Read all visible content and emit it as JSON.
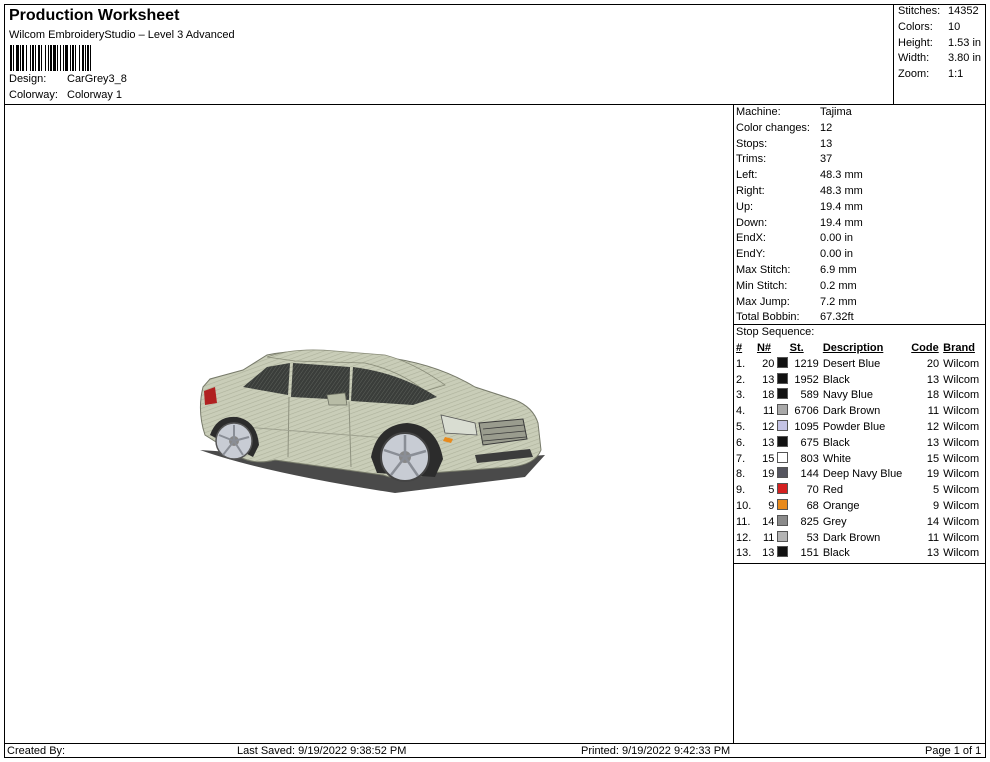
{
  "header": {
    "title": "Production Worksheet",
    "subtitle": "Wilcom EmbroideryStudio – Level 3 Advanced",
    "design_label": "Design:",
    "design_value": "CarGrey3_8",
    "colorway_label": "Colorway:",
    "colorway_value": "Colorway 1"
  },
  "summary": [
    {
      "label": "Stitches:",
      "value": "14352"
    },
    {
      "label": "Colors:",
      "value": "10"
    },
    {
      "label": "Height:",
      "value": "1.53 in"
    },
    {
      "label": "Width:",
      "value": "3.80 in"
    },
    {
      "label": "Zoom:",
      "value": "1:1"
    }
  ],
  "properties": [
    {
      "label": "Machine:",
      "value": "Tajima"
    },
    {
      "label": "Color changes:",
      "value": "12"
    },
    {
      "label": "Stops:",
      "value": "13"
    },
    {
      "label": "Trims:",
      "value": "37"
    },
    {
      "label": "Left:",
      "value": "48.3 mm"
    },
    {
      "label": "Right:",
      "value": "48.3 mm"
    },
    {
      "label": "Up:",
      "value": "19.4 mm"
    },
    {
      "label": "Down:",
      "value": "19.4 mm"
    },
    {
      "label": "EndX:",
      "value": "0.00 in"
    },
    {
      "label": "EndY:",
      "value": "0.00 in"
    },
    {
      "label": "Max Stitch:",
      "value": "6.9 mm"
    },
    {
      "label": "Min Stitch:",
      "value": "0.2 mm"
    },
    {
      "label": "Max Jump:",
      "value": "7.2 mm"
    },
    {
      "label": "Total Bobbin:",
      "value": "67.32ft"
    }
  ],
  "stop_sequence": {
    "title": "Stop Sequence:",
    "headers": {
      "num": "#",
      "n": "N#",
      "st": "St.",
      "desc": "Description",
      "code": "Code",
      "brand": "Brand"
    },
    "rows": [
      {
        "num": "1.",
        "n": "20",
        "color": "#111111",
        "st": "1219",
        "desc": "Desert Blue",
        "code": "20",
        "brand": "Wilcom"
      },
      {
        "num": "2.",
        "n": "13",
        "color": "#111111",
        "st": "1952",
        "desc": "Black",
        "code": "13",
        "brand": "Wilcom"
      },
      {
        "num": "3.",
        "n": "18",
        "color": "#111111",
        "st": "589",
        "desc": "Navy Blue",
        "code": "18",
        "brand": "Wilcom"
      },
      {
        "num": "4.",
        "n": "11",
        "color": "#a9a9a9",
        "st": "6706",
        "desc": "Dark Brown",
        "code": "11",
        "brand": "Wilcom"
      },
      {
        "num": "5.",
        "n": "12",
        "color": "#c4c3e4",
        "st": "1095",
        "desc": "Powder Blue",
        "code": "12",
        "brand": "Wilcom"
      },
      {
        "num": "6.",
        "n": "13",
        "color": "#111111",
        "st": "675",
        "desc": "Black",
        "code": "13",
        "brand": "Wilcom"
      },
      {
        "num": "7.",
        "n": "15",
        "color": "#ffffff",
        "st": "803",
        "desc": "White",
        "code": "15",
        "brand": "Wilcom"
      },
      {
        "num": "8.",
        "n": "19",
        "color": "#55555f",
        "st": "144",
        "desc": "Deep Navy Blue",
        "code": "19",
        "brand": "Wilcom"
      },
      {
        "num": "9.",
        "n": "5",
        "color": "#d42020",
        "st": "70",
        "desc": "Red",
        "code": "5",
        "brand": "Wilcom"
      },
      {
        "num": "10.",
        "n": "9",
        "color": "#e88a1c",
        "st": "68",
        "desc": "Orange",
        "code": "9",
        "brand": "Wilcom"
      },
      {
        "num": "11.",
        "n": "14",
        "color": "#8a8a8a",
        "st": "825",
        "desc": "Grey",
        "code": "14",
        "brand": "Wilcom"
      },
      {
        "num": "12.",
        "n": "11",
        "color": "#b4b4b4",
        "st": "53",
        "desc": "Dark Brown",
        "code": "11",
        "brand": "Wilcom"
      },
      {
        "num": "13.",
        "n": "13",
        "color": "#111111",
        "st": "151",
        "desc": "Black",
        "code": "13",
        "brand": "Wilcom"
      }
    ]
  },
  "footer": {
    "created_by": "Created By:",
    "last_saved": "Last Saved: 9/19/2022 9:38:52 PM",
    "printed": "Printed: 9/19/2022 9:42:33 PM",
    "page": "Page 1 of 1"
  }
}
